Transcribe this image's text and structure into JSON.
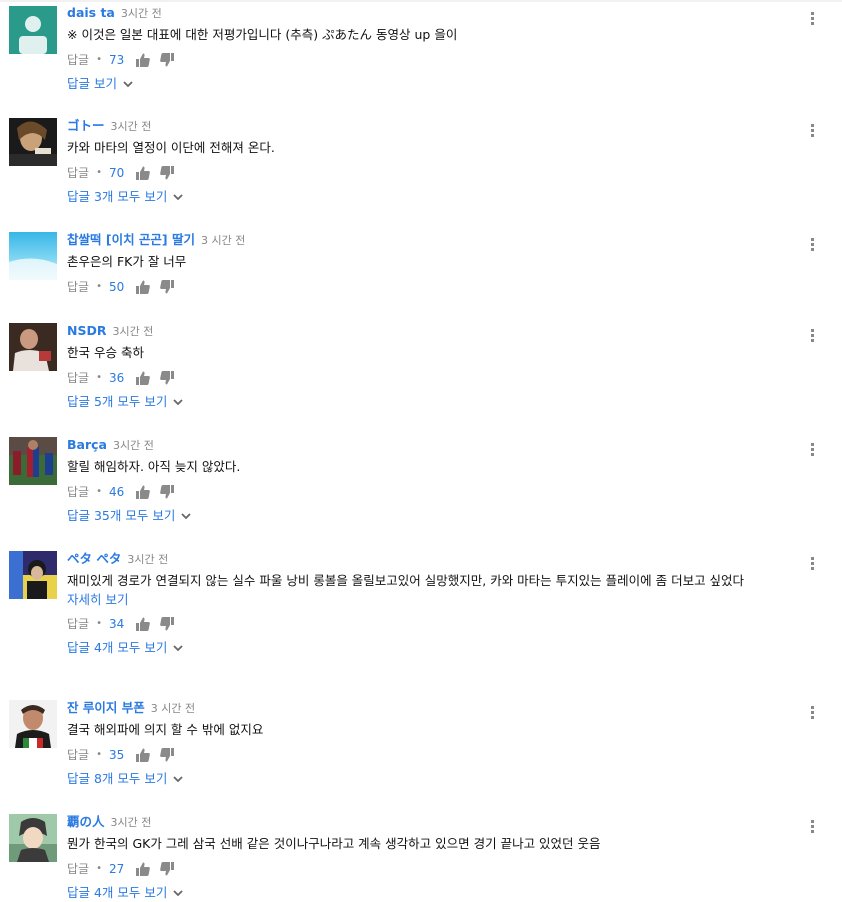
{
  "labels": {
    "reply": "답글",
    "read_more": "자세히 보기"
  },
  "comments": [
    {
      "author": "dais ta",
      "time": "3시간 전",
      "text": "※ 이것은 일본 대표에 대한 저평가입니다 (추측) ぷあたん 동영상 up 을이",
      "likes": "73",
      "replies": "답글 보기"
    },
    {
      "author": "ゴトー",
      "time": "3시간 전",
      "text": "카와 마타의 열정이 이단에 전해져 온다.",
      "likes": "70",
      "replies": "답글 3개 모두 보기"
    },
    {
      "author": "찹쌀떡 [이치 곤곤] 딸기",
      "time": "3 시간 전",
      "text": "촌우은의 FK가 잘 너무",
      "likes": "50",
      "replies": ""
    },
    {
      "author": "NSDR",
      "time": "3시간 전",
      "text": "한국 우승 축하",
      "likes": "36",
      "replies": "답글 5개 모두 보기"
    },
    {
      "author": "Barça",
      "time": "3시간 전",
      "text": "할릴 해임하자. 아직 늦지 않았다.",
      "likes": "46",
      "replies": "답글 35개 모두 보기"
    },
    {
      "author": "ペタ ペタ",
      "time": "3시간 전",
      "text": "재미있게 경로가 연결되지 않는 실수 파울 낭비 롱볼을 올릴보고있어 실망했지만, 카와 마타는 투지있는 플레이에 좀 더보고 싶었다",
      "likes": "34",
      "replies": "답글 4개 모두 보기",
      "read_more": true
    },
    {
      "author": "잔 루이지 부폰",
      "time": "3 시간 전",
      "text": "결국 해외파에 의지 할 수 밖에 없지요",
      "likes": "35",
      "replies": "답글 8개 모두 보기"
    },
    {
      "author": "覇の人",
      "time": "3시간 전",
      "text": "뭔가 한국의 GK가 그레 삼국 선배 같은 것이나구나라고 계속 생각하고 있으면 경기 끝나고 있었던 웃음",
      "likes": "27",
      "replies": "답글 4개 모두 보기"
    }
  ],
  "icons": {
    "like": "thumb-up-icon",
    "dislike": "thumb-down-icon",
    "menu": "more-vert-icon",
    "chevron": "chevron-down-icon"
  },
  "colors": {
    "link": "#2a7ae2",
    "meta": "#888888",
    "text": "#111111"
  }
}
